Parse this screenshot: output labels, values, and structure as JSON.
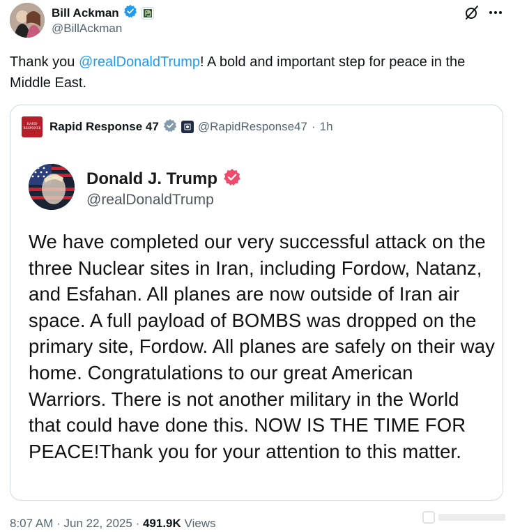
{
  "tweet": {
    "author": {
      "name": "Bill Ackman",
      "handle": "@BillAckman",
      "verified_color": "#1d9bf0"
    },
    "text_before_mention": "Thank you ",
    "mention": "@realDonaldTrump",
    "text_after_mention": "! A bold and important step for peace in the Middle East.",
    "timestamp": "8:07 AM",
    "separator": "·",
    "date": "Jun 22, 2025",
    "views_count": "491.9K",
    "views_label": "Views"
  },
  "quote": {
    "author_name": "Rapid Response 47",
    "logo_text_line1": "RAPID",
    "logo_text_line2": "RESPONSE",
    "handle": "@RapidResponse47",
    "separator": "·",
    "time": "1h",
    "embed": {
      "name": "Donald J. Trump",
      "handle": "@realDonaldTrump",
      "badge_color": "#ef4a6b",
      "body": "We have completed our very successful attack on the three Nuclear sites in Iran, including Fordow, Natanz, and Esfahan. All planes are now outside of Iran air space. A full payload of BOMBS was dropped on the primary site, Fordow. All planes are safely on their way home. Congratulations to our great American Warriors. There is not another military in the World that could have done this. NOW IS THE TIME FOR PEACE!Thank you for your attention to this matter."
    }
  },
  "icons": {
    "verified": "verified-badge-icon",
    "affiliate": "affiliate-badge-icon",
    "grok": "grok-icon",
    "more": "more-icon",
    "gov": "government-badge-icon"
  }
}
